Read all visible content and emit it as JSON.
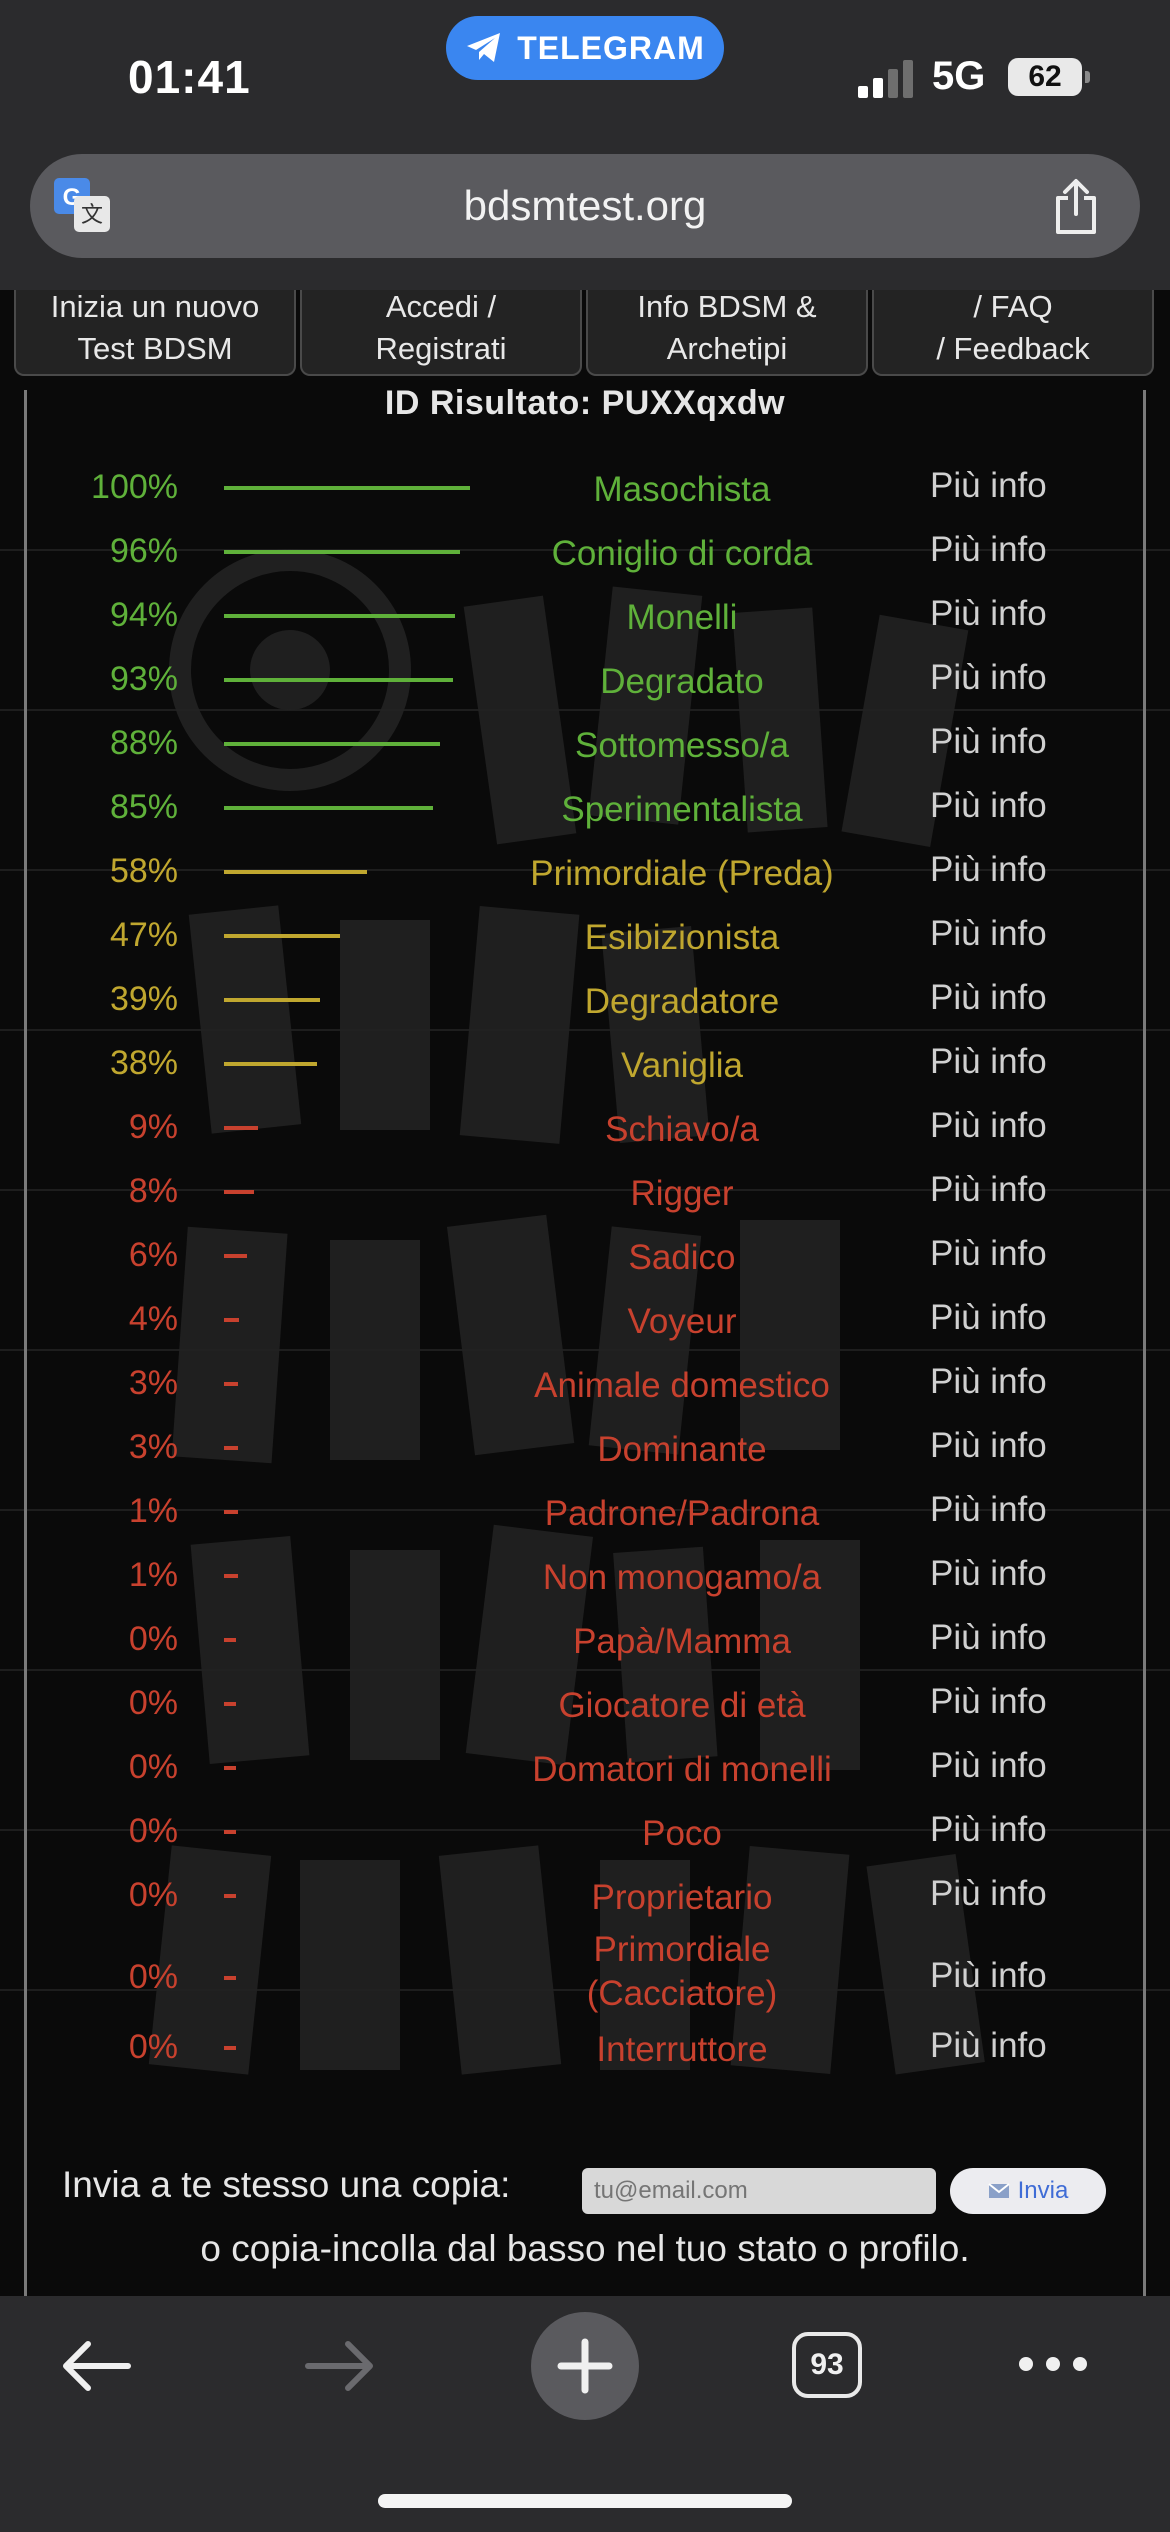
{
  "status_bar": {
    "time": "01:41",
    "pill_label": "TELEGRAM",
    "network": "5G",
    "battery": "62"
  },
  "browser": {
    "url": "bdsmtest.org",
    "tab_count": "93"
  },
  "nav": [
    {
      "line1": "Inizia un nuovo",
      "line2": "Test BDSM"
    },
    {
      "line1": "Accedi /",
      "line2": "Registrati"
    },
    {
      "line1": "Info BDSM &",
      "line2": "Archetipi"
    },
    {
      "line1": "/ FAQ",
      "line2": "/ Feedback"
    }
  ],
  "result_id": "ID Risultato: PUXXqxdw",
  "more_label": "Più info",
  "colors": {
    "green": "#5fb13a",
    "yellow": "#c0a72f",
    "red": "#c8412e"
  },
  "results": [
    {
      "percent": "100%",
      "value": 100,
      "name": "Masochista",
      "level": "green"
    },
    {
      "percent": "96%",
      "value": 96,
      "name": "Coniglio di corda",
      "level": "green"
    },
    {
      "percent": "94%",
      "value": 94,
      "name": "Monelli",
      "level": "green"
    },
    {
      "percent": "93%",
      "value": 93,
      "name": "Degradato",
      "level": "green"
    },
    {
      "percent": "88%",
      "value": 88,
      "name": "Sottomesso/a",
      "level": "green"
    },
    {
      "percent": "85%",
      "value": 85,
      "name": "Sperimentalista",
      "level": "green"
    },
    {
      "percent": "58%",
      "value": 58,
      "name": "Primordiale (Preda)",
      "level": "yellow"
    },
    {
      "percent": "47%",
      "value": 47,
      "name": "Esibizionista",
      "level": "yellow"
    },
    {
      "percent": "39%",
      "value": 39,
      "name": "Degradatore",
      "level": "yellow"
    },
    {
      "percent": "38%",
      "value": 38,
      "name": "Vaniglia",
      "level": "yellow"
    },
    {
      "percent": "9%",
      "value": 9,
      "name": "Schiavo/a",
      "level": "red"
    },
    {
      "percent": "8%",
      "value": 8,
      "name": "Rigger",
      "level": "red"
    },
    {
      "percent": "6%",
      "value": 6,
      "name": "Sadico",
      "level": "red"
    },
    {
      "percent": "4%",
      "value": 4,
      "name": "Voyeur",
      "level": "red"
    },
    {
      "percent": "3%",
      "value": 3,
      "name": "Animale domestico",
      "level": "red"
    },
    {
      "percent": "3%",
      "value": 3,
      "name": "Dominante",
      "level": "red"
    },
    {
      "percent": "1%",
      "value": 1,
      "name": "Padrone/Padrona",
      "level": "red"
    },
    {
      "percent": "1%",
      "value": 1,
      "name": "Non monogamo/a",
      "level": "red"
    },
    {
      "percent": "0%",
      "value": 0,
      "name": "Papà/Mamma",
      "level": "red"
    },
    {
      "percent": "0%",
      "value": 0,
      "name": "Giocatore di età",
      "level": "red"
    },
    {
      "percent": "0%",
      "value": 0,
      "name": "Domatori di monelli",
      "level": "red"
    },
    {
      "percent": "0%",
      "value": 0,
      "name": "Poco",
      "level": "red"
    },
    {
      "percent": "0%",
      "value": 0,
      "name": "Proprietario",
      "level": "red"
    },
    {
      "percent": "0%",
      "value": 0,
      "name": "Primordiale (Cacciatore)",
      "level": "red"
    },
    {
      "percent": "0%",
      "value": 0,
      "name": "Interruttore",
      "level": "red"
    }
  ],
  "send": {
    "label": "Invia a te stesso una copia:",
    "placeholder": "tu@email.com",
    "button": "Invia"
  },
  "copy_hint": "o copia-incolla dal basso nel tuo stato o profilo."
}
